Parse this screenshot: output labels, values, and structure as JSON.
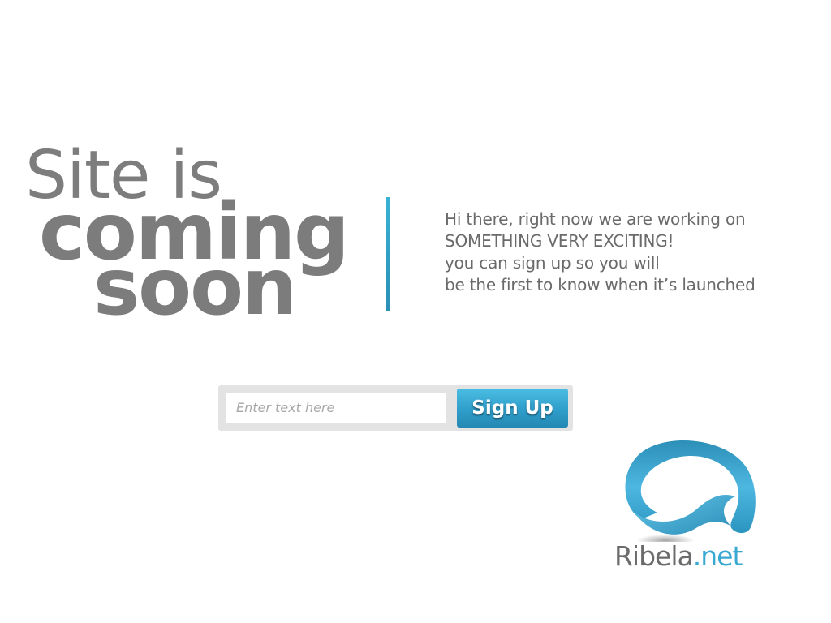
{
  "headline": {
    "line1": "Site is",
    "line2": "coming",
    "line3": "soon"
  },
  "message": {
    "lines": [
      "Hi there, right now we are working on",
      "SOMETHING VERY EXCITING!",
      "you can sign up so you will",
      "be the first to know when it’s launched"
    ]
  },
  "signup": {
    "placeholder": "Enter text here",
    "value": "",
    "button_label": "Sign Up"
  },
  "logo": {
    "name": "Ribela",
    "tld": ".net",
    "icon": "wave-logo-icon"
  },
  "colors": {
    "accent": "#2fa0cc",
    "text_gray": "#7c7c7c",
    "form_bg": "#e3e3e3"
  }
}
